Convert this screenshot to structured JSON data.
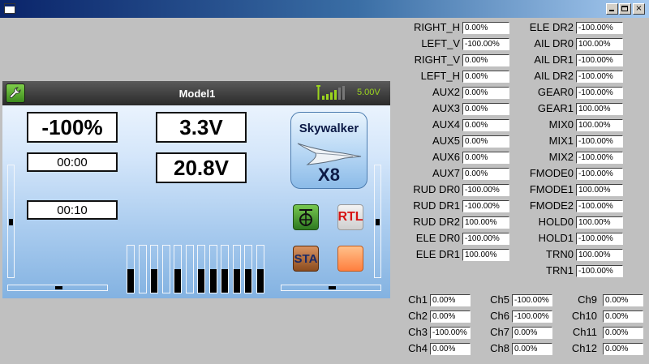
{
  "window": {
    "min_label": "",
    "max_label": "",
    "close_label": "×"
  },
  "screen": {
    "model_name": "Model1",
    "voltage": "5.00V",
    "throttle": "-100%",
    "timer1": "00:00",
    "timer2": "00:10",
    "voltage1": "3.3V",
    "voltage2": "20.8V",
    "model_icon": {
      "title": "Skywalker",
      "subtitle": "X8"
    },
    "icons": {
      "rtl": "RTL",
      "sta": "STA"
    },
    "trims": {
      "left_vertical": 0.5,
      "right_vertical": 0.5,
      "left_horizontal": 0.5,
      "right_horizontal": 0.5
    },
    "bars": [
      0.5,
      0,
      0.5,
      0,
      0.5,
      0,
      0.5,
      0.5,
      0.5,
      0.5,
      0.5,
      0.5
    ],
    "colors": {
      "accent": "#9bd41e",
      "rtl": "#d61313"
    }
  },
  "params_left": [
    {
      "label": "RIGHT_H",
      "value": "0.00%"
    },
    {
      "label": "LEFT_V",
      "value": "-100.00%"
    },
    {
      "label": "RIGHT_V",
      "value": "0.00%"
    },
    {
      "label": "LEFT_H",
      "value": "0.00%"
    },
    {
      "label": "AUX2",
      "value": "0.00%"
    },
    {
      "label": "AUX3",
      "value": "0.00%"
    },
    {
      "label": "AUX4",
      "value": "0.00%"
    },
    {
      "label": "AUX5",
      "value": "0.00%"
    },
    {
      "label": "AUX6",
      "value": "0.00%"
    },
    {
      "label": "AUX7",
      "value": "0.00%"
    },
    {
      "label": "RUD DR0",
      "value": "-100.00%"
    },
    {
      "label": "RUD DR1",
      "value": "-100.00%"
    },
    {
      "label": "RUD DR2",
      "value": "100.00%"
    },
    {
      "label": "ELE DR0",
      "value": "-100.00%"
    },
    {
      "label": "ELE DR1",
      "value": "100.00%"
    }
  ],
  "params_right": [
    {
      "label": "ELE DR2",
      "value": "-100.00%"
    },
    {
      "label": "AIL DR0",
      "value": "100.00%"
    },
    {
      "label": "AIL DR1",
      "value": "-100.00%"
    },
    {
      "label": "AIL DR2",
      "value": "-100.00%"
    },
    {
      "label": "GEAR0",
      "value": "-100.00%"
    },
    {
      "label": "GEAR1",
      "value": "100.00%"
    },
    {
      "label": "MIX0",
      "value": "100.00%"
    },
    {
      "label": "MIX1",
      "value": "-100.00%"
    },
    {
      "label": "MIX2",
      "value": "-100.00%"
    },
    {
      "label": "FMODE0",
      "value": "-100.00%"
    },
    {
      "label": "FMODE1",
      "value": "100.00%"
    },
    {
      "label": "FMODE2",
      "value": "-100.00%"
    },
    {
      "label": "HOLD0",
      "value": "100.00%"
    },
    {
      "label": "HOLD1",
      "value": "-100.00%"
    },
    {
      "label": "TRN0",
      "value": "100.00%"
    },
    {
      "label": "TRN1",
      "value": "-100.00%"
    }
  ],
  "channels": [
    {
      "label": "Ch1",
      "value": "0.00%"
    },
    {
      "label": "Ch2",
      "value": "0.00%"
    },
    {
      "label": "Ch3",
      "value": "-100.00%"
    },
    {
      "label": "Ch4",
      "value": "0.00%"
    },
    {
      "label": "Ch5",
      "value": "-100.00%"
    },
    {
      "label": "Ch6",
      "value": "-100.00%"
    },
    {
      "label": "Ch7",
      "value": "0.00%"
    },
    {
      "label": "Ch8",
      "value": "0.00%"
    },
    {
      "label": "Ch9",
      "value": "0.00%"
    },
    {
      "label": "Ch10",
      "value": "0.00%"
    },
    {
      "label": "Ch11",
      "value": "0.00%"
    },
    {
      "label": "Ch12",
      "value": "0.00%"
    }
  ]
}
